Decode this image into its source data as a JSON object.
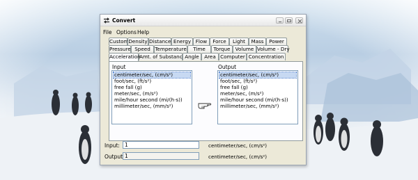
{
  "window": {
    "title": "Convert",
    "icon": "convert-arrows-icon",
    "controls": [
      "minimize-icon",
      "maximize-icon",
      "close-icon"
    ]
  },
  "menu": [
    "File",
    "Options",
    "Help"
  ],
  "tabs": {
    "row1": [
      "Custom",
      "Density",
      "Distance",
      "Energy",
      "Flow",
      "Force",
      "Light",
      "Mass",
      "Power"
    ],
    "row2": [
      "Pressure",
      "Speed",
      "Temperature",
      "Time",
      "Torque",
      "Volume",
      "Volume - Dry"
    ],
    "row3": [
      "Acceleration",
      "Amt. of Substance",
      "Angle",
      "Area",
      "Computer",
      "Concentration"
    ],
    "active": "Acceleration"
  },
  "input_list": {
    "label": "Input",
    "items": [
      "centimeter/sec, (cm/s²)",
      "foot/sec, (ft/s²)",
      "free fall (g)",
      "meter/sec, (m/s²)",
      "mile/hour second (mi/(h·s))",
      "millimeter/sec, (mm/s²)"
    ],
    "selected_index": 0
  },
  "output_list": {
    "label": "Output",
    "items": [
      "centimeter/sec, (cm/s²)",
      "foot/sec, (ft/s²)",
      "free fall (g)",
      "meter/sec, (m/s²)",
      "mile/hour second (mi/(h·s))",
      "millimeter/sec, (mm/s²)"
    ],
    "selected_index": 0,
    "arrow_icon": "pointing-hand-icon"
  },
  "fields": {
    "input_label": "Input:",
    "input_value": "1",
    "input_unit": "centimeter/sec, (cm/s²)",
    "output_label": "Output:",
    "output_value": "1",
    "output_unit": "centimeter/sec, (cm/s²)"
  },
  "colors": {
    "window_bg": "#ece9d8",
    "selection": "#c7d9f2",
    "field_border": "#7f9db9"
  }
}
